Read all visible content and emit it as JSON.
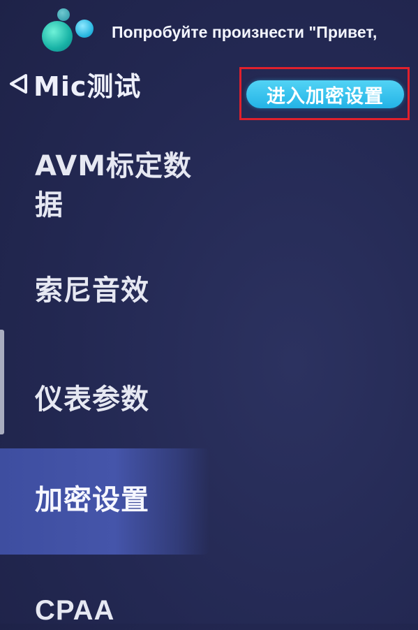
{
  "voice": {
    "hint": "Попробуйте произнести \"Привет,"
  },
  "header": {
    "back_label": "Mic测试",
    "back_icon": "back-triangle-icon",
    "action_button": "进入加密设置"
  },
  "sidebar": {
    "items": [
      {
        "label": "AVM标定数据",
        "active": false
      },
      {
        "label": "索尼音效",
        "active": false
      },
      {
        "label": "仪表参数",
        "active": false
      },
      {
        "label": "加密设置",
        "active": true
      },
      {
        "label": "CPAA",
        "active": false
      }
    ]
  },
  "colors": {
    "background": "#232852",
    "action_button": "#2fbfec",
    "highlight": "#e0202c",
    "active_item": "#4555aa"
  }
}
